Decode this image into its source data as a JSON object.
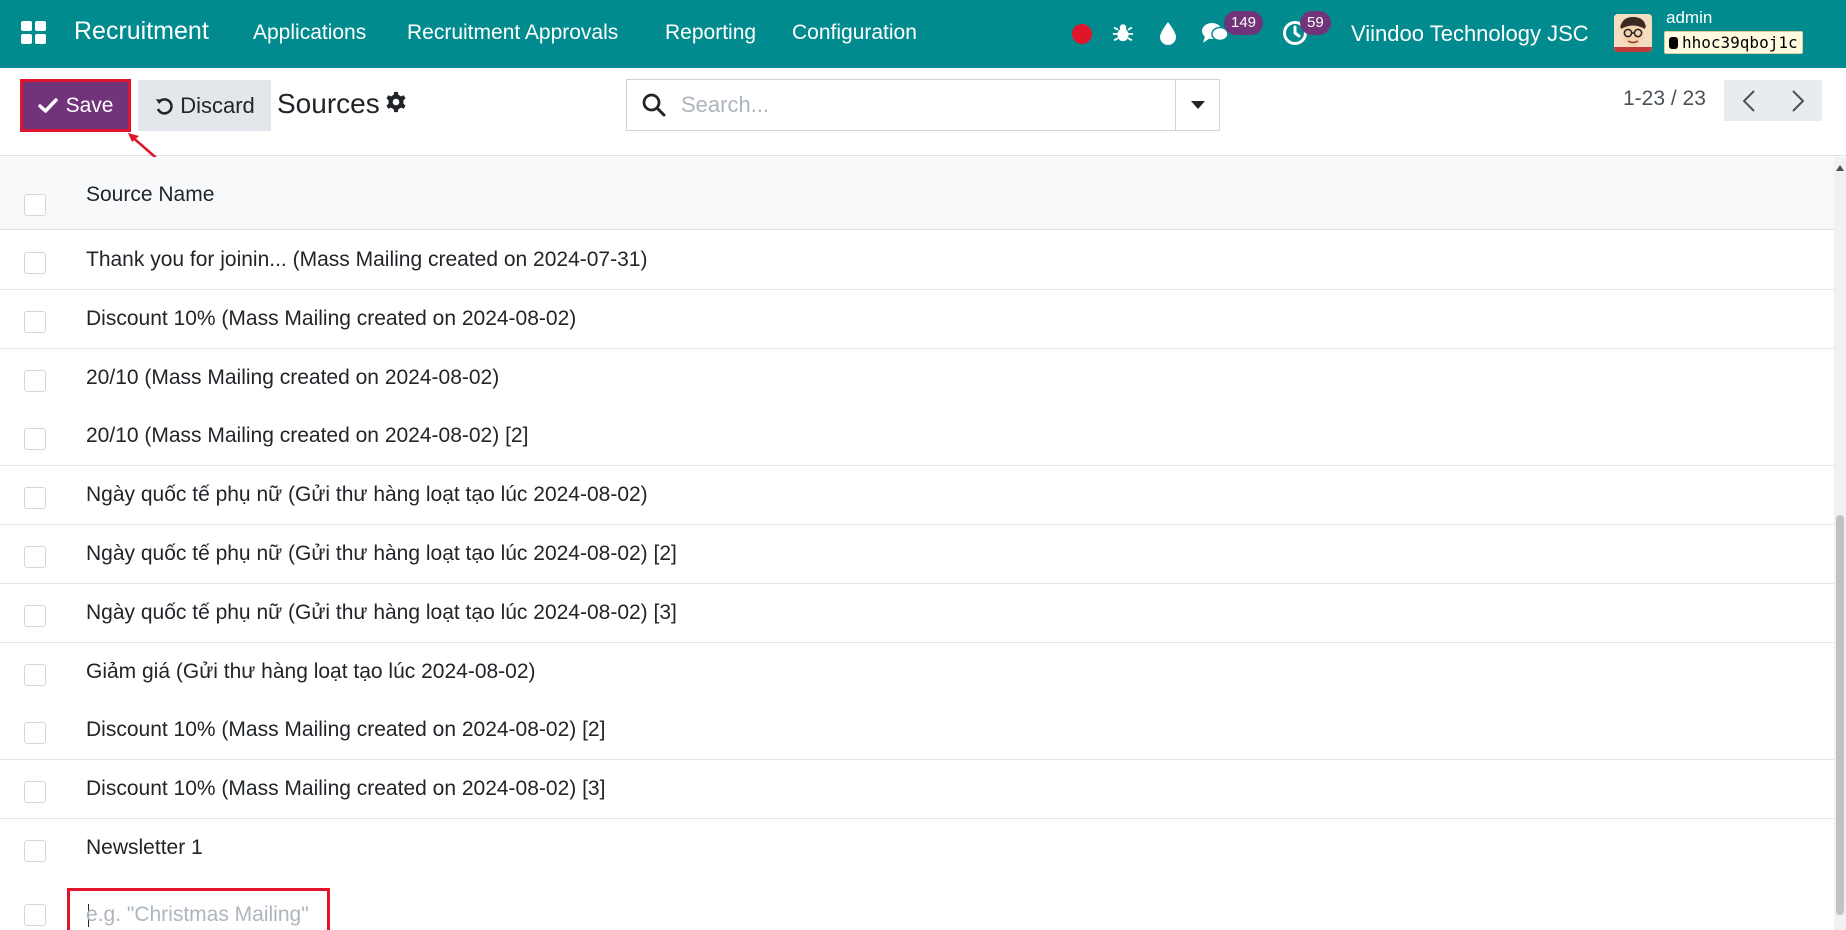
{
  "navbar": {
    "brand": "Recruitment",
    "menu": [
      "Applications",
      "Recruitment Approvals",
      "Reporting",
      "Configuration"
    ],
    "messages_count": "149",
    "activities_count": "59",
    "company": "Viindoo Technology JSC",
    "user": "admin",
    "database": "hhoc39qboj1c",
    "icons": [
      "apps-grid-icon",
      "record-dot-icon",
      "bug-icon",
      "droplet-icon",
      "chat-icon",
      "clock-icon",
      "avatar"
    ],
    "colors": {
      "navbar": "#018b8f",
      "primary": "#71337a",
      "highlight": "#e0142a"
    }
  },
  "control_panel": {
    "save_label": "Save",
    "discard_label": "Discard",
    "breadcrumb": "Sources",
    "search_placeholder": "Search...",
    "pager": "1-23 / 23"
  },
  "list": {
    "column_header": "Source Name",
    "rows": [
      "Thank you for joinin... (Mass Mailing created on 2024-07-31)",
      "Discount 10% (Mass Mailing created on 2024-08-02)",
      "20/10 (Mass Mailing created on 2024-08-02)",
      "20/10 (Mass Mailing created on 2024-08-02) [2]",
      "Ngày quốc tế phụ nữ (Gửi thư hàng loạt tạo lúc 2024-08-02)",
      "Ngày quốc tế phụ nữ (Gửi thư hàng loạt tạo lúc 2024-08-02) [2]",
      "Ngày quốc tế phụ nữ (Gửi thư hàng loạt tạo lúc 2024-08-02) [3]",
      "Giảm giá (Gửi thư hàng loạt tạo lúc 2024-08-02)",
      "Discount 10% (Mass Mailing created on 2024-08-02) [2]",
      "Discount 10% (Mass Mailing created on 2024-08-02) [3]",
      "Newsletter 1"
    ],
    "new_row_placeholder": "e.g. \"Christmas Mailing\""
  }
}
